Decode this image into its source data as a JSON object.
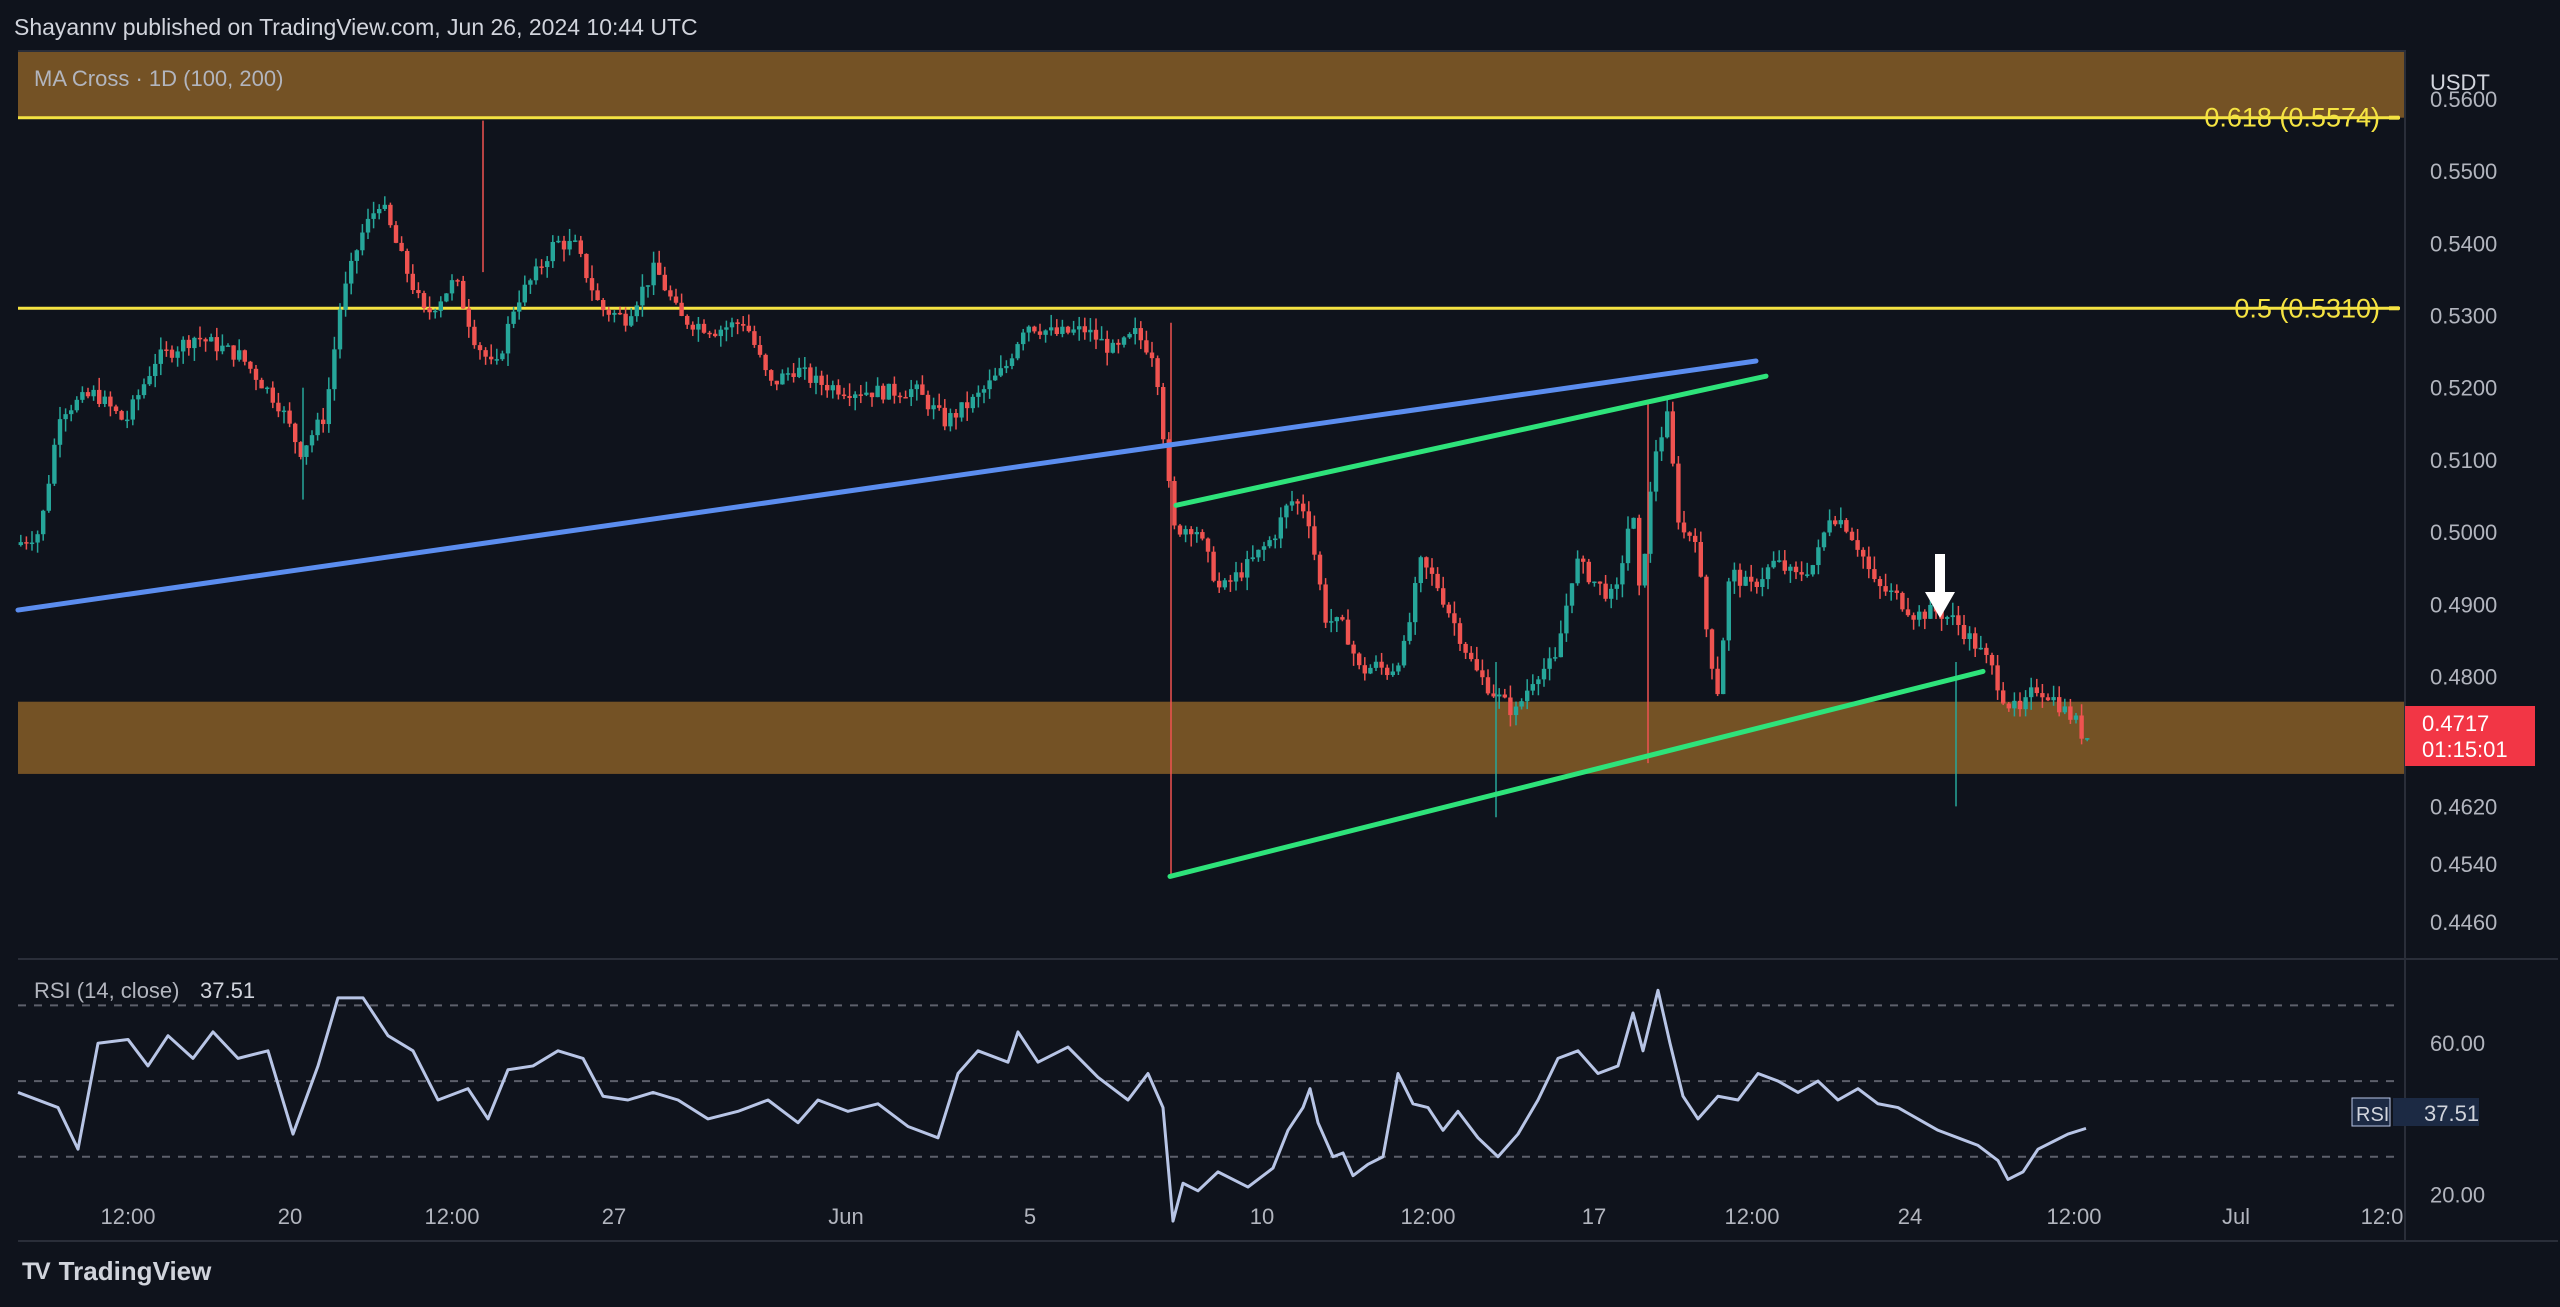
{
  "header": {
    "published": "Shayannv published on TradingView.com, Jun 26, 2024 10:44 UTC"
  },
  "brand": {
    "logo": "TV",
    "name": "TradingView"
  },
  "colors": {
    "up": "#26a69a",
    "down": "#ef5350",
    "zone": "#7a5526",
    "fib": "#f5e342",
    "blue_line": "#5b8def",
    "green_line": "#2ee37a",
    "rsi_line": "#b8c5e6",
    "price_tag": "#f23645"
  },
  "chart_data": [
    {
      "type": "candlestick",
      "title": "",
      "indicator_label": "MA Cross · 1D (100, 200)",
      "currency": "USDT",
      "x_tick_labels": [
        "12:00",
        "20",
        "12:00",
        "27",
        "Jun",
        "5",
        "10",
        "12:00",
        "17",
        "12:00",
        "24",
        "12:00",
        "Jul",
        "12:0"
      ],
      "y_tick_labels": [
        "0.5600",
        "0.5500",
        "0.5400",
        "0.5300",
        "0.5200",
        "0.5100",
        "0.5000",
        "0.4900",
        "0.4800",
        "0.4620",
        "0.4540",
        "0.4460"
      ],
      "y_tick_values": [
        0.56,
        0.55,
        0.54,
        0.53,
        0.52,
        0.51,
        0.5,
        0.49,
        0.48,
        0.462,
        0.454,
        0.446
      ],
      "ylim": [
        0.441,
        0.5665
      ],
      "grid": false,
      "zones": [
        {
          "from": 0.5574,
          "to": 0.5665,
          "label": ""
        },
        {
          "from": 0.4665,
          "to": 0.4765,
          "label": ""
        }
      ],
      "fib_levels": [
        {
          "value": 0.5574,
          "label": "0.618 (0.5574)"
        },
        {
          "value": 0.531,
          "label": "0.5 (0.5310)"
        }
      ],
      "trendlines": [
        {
          "name": "",
          "color": "blue",
          "points": [
            [
              0,
              0.4892
            ],
            [
              1738,
              0.5237
            ]
          ]
        },
        {
          "name": "",
          "color": "green",
          "points": [
            [
              1158,
              0.5037
            ],
            [
              1748,
              0.5216
            ]
          ]
        },
        {
          "name": "",
          "color": "green",
          "points": [
            [
              1152,
              0.4523
            ],
            [
              1965,
              0.4807
            ]
          ]
        }
      ],
      "last_price": {
        "value": 0.4717,
        "label": "0.4717",
        "countdown": "01:15:01"
      },
      "annotation": {
        "type": "down-arrow",
        "x": 1940,
        "y": 0.4935
      },
      "series_points": [
        [
          0,
          0.4982
        ],
        [
          25,
          0.5001
        ],
        [
          45,
          0.5168
        ],
        [
          80,
          0.5192
        ],
        [
          110,
          0.5152
        ],
        [
          140,
          0.5238
        ],
        [
          180,
          0.5271
        ],
        [
          225,
          0.5244
        ],
        [
          265,
          0.5175
        ],
        [
          285,
          0.5112
        ],
        [
          310,
          0.5162
        ],
        [
          325,
          0.5312
        ],
        [
          345,
          0.5408
        ],
        [
          365,
          0.546
        ],
        [
          385,
          0.5384
        ],
        [
          410,
          0.5299
        ],
        [
          440,
          0.5349
        ],
        [
          460,
          0.5266
        ],
        [
          480,
          0.5222
        ],
        [
          500,
          0.5318
        ],
        [
          520,
          0.5356
        ],
        [
          540,
          0.5402
        ],
        [
          560,
          0.5396
        ],
        [
          585,
          0.531
        ],
        [
          610,
          0.5296
        ],
        [
          640,
          0.5366
        ],
        [
          665,
          0.5296
        ],
        [
          700,
          0.528
        ],
        [
          730,
          0.5292
        ],
        [
          755,
          0.5203
        ],
        [
          780,
          0.5227
        ],
        [
          800,
          0.5208
        ],
        [
          830,
          0.5197
        ],
        [
          870,
          0.5194
        ],
        [
          900,
          0.5197
        ],
        [
          930,
          0.5153
        ],
        [
          960,
          0.5184
        ],
        [
          990,
          0.5227
        ],
        [
          1010,
          0.529
        ],
        [
          1040,
          0.5274
        ],
        [
          1070,
          0.528
        ],
        [
          1100,
          0.5249
        ],
        [
          1120,
          0.5275
        ],
        [
          1140,
          0.5244
        ],
        [
          1158,
          0.5003
        ],
        [
          1180,
          0.5009
        ],
        [
          1205,
          0.4918
        ],
        [
          1235,
          0.4957
        ],
        [
          1258,
          0.4993
        ],
        [
          1275,
          0.5044
        ],
        [
          1292,
          0.503
        ],
        [
          1310,
          0.4882
        ],
        [
          1330,
          0.4866
        ],
        [
          1345,
          0.4806
        ],
        [
          1360,
          0.4815
        ],
        [
          1375,
          0.4806
        ],
        [
          1390,
          0.4842
        ],
        [
          1405,
          0.4957
        ],
        [
          1420,
          0.4933
        ],
        [
          1440,
          0.4871
        ],
        [
          1460,
          0.4808
        ],
        [
          1480,
          0.4775
        ],
        [
          1500,
          0.4749
        ],
        [
          1520,
          0.4804
        ],
        [
          1540,
          0.482
        ],
        [
          1560,
          0.4961
        ],
        [
          1580,
          0.493
        ],
        [
          1600,
          0.4906
        ],
        [
          1620,
          0.4872
        ],
        [
          1600,
          0.4906
        ],
        [
          1618,
          0.5047
        ],
        [
          1630,
          0.4983
        ],
        [
          1640,
          0.5112
        ],
        [
          1652,
          0.5158
        ],
        [
          1665,
          0.4999
        ],
        [
          1680,
          0.4997
        ],
        [
          1690,
          0.4876
        ],
        [
          1702,
          0.4776
        ],
        [
          1715,
          0.4946
        ],
        [
          1735,
          0.4922
        ],
        [
          1760,
          0.4959
        ],
        [
          1780,
          0.4938
        ],
        [
          1800,
          0.4957
        ],
        [
          1815,
          0.5026
        ],
        [
          1830,
          0.5012
        ],
        [
          1845,
          0.4976
        ],
        [
          1860,
          0.4925
        ],
        [
          1880,
          0.4912
        ],
        [
          1900,
          0.4885
        ],
        [
          1920,
          0.4891
        ],
        [
          1940,
          0.4877
        ],
        [
          1960,
          0.4844
        ],
        [
          1975,
          0.4816
        ],
        [
          1990,
          0.4766
        ],
        [
          2005,
          0.4749
        ],
        [
          2020,
          0.4785
        ],
        [
          2035,
          0.4774
        ],
        [
          2050,
          0.4752
        ],
        [
          2060,
          0.4739
        ],
        [
          2068,
          0.4717
        ]
      ]
    },
    {
      "type": "line",
      "title": "",
      "indicator_label": "RSI (14, close)",
      "indicator_value": "37.51",
      "y_tick_labels": [
        "60.00",
        "20.00"
      ],
      "y_tick_values": [
        60,
        20
      ],
      "ylim": [
        8,
        82
      ],
      "guides": [
        70,
        50,
        30
      ],
      "last_value": {
        "label": "RSI",
        "value": "37.51"
      },
      "series_points": [
        [
          0,
          47
        ],
        [
          40,
          43
        ],
        [
          60,
          32
        ],
        [
          80,
          60
        ],
        [
          110,
          61
        ],
        [
          130,
          54
        ],
        [
          150,
          62
        ],
        [
          175,
          56
        ],
        [
          195,
          63
        ],
        [
          220,
          56
        ],
        [
          250,
          58
        ],
        [
          275,
          36
        ],
        [
          300,
          54
        ],
        [
          320,
          72
        ],
        [
          345,
          72
        ],
        [
          370,
          62
        ],
        [
          395,
          58
        ],
        [
          420,
          45
        ],
        [
          450,
          48
        ],
        [
          470,
          40
        ],
        [
          490,
          53
        ],
        [
          515,
          54
        ],
        [
          540,
          58
        ],
        [
          565,
          56
        ],
        [
          585,
          46
        ],
        [
          610,
          45
        ],
        [
          635,
          47
        ],
        [
          660,
          45
        ],
        [
          690,
          40
        ],
        [
          720,
          42
        ],
        [
          750,
          45
        ],
        [
          780,
          39
        ],
        [
          800,
          45
        ],
        [
          830,
          42
        ],
        [
          860,
          44
        ],
        [
          890,
          38
        ],
        [
          920,
          35
        ],
        [
          940,
          52
        ],
        [
          960,
          58
        ],
        [
          990,
          55
        ],
        [
          1000,
          63
        ],
        [
          1020,
          55
        ],
        [
          1050,
          59
        ],
        [
          1080,
          51
        ],
        [
          1110,
          45
        ],
        [
          1130,
          52
        ],
        [
          1145,
          43
        ],
        [
          1155,
          13
        ],
        [
          1165,
          23
        ],
        [
          1180,
          21
        ],
        [
          1200,
          26
        ],
        [
          1230,
          22
        ],
        [
          1255,
          27
        ],
        [
          1270,
          37
        ],
        [
          1285,
          43
        ],
        [
          1292,
          48
        ],
        [
          1300,
          39
        ],
        [
          1315,
          30
        ],
        [
          1325,
          31
        ],
        [
          1335,
          25
        ],
        [
          1350,
          28
        ],
        [
          1365,
          30
        ],
        [
          1380,
          52
        ],
        [
          1395,
          44
        ],
        [
          1410,
          43
        ],
        [
          1425,
          37
        ],
        [
          1440,
          42
        ],
        [
          1460,
          35
        ],
        [
          1480,
          30
        ],
        [
          1500,
          36
        ],
        [
          1520,
          45
        ],
        [
          1540,
          56
        ],
        [
          1560,
          58
        ],
        [
          1580,
          52
        ],
        [
          1600,
          54
        ],
        [
          1615,
          68
        ],
        [
          1625,
          58
        ],
        [
          1640,
          74
        ],
        [
          1652,
          60
        ],
        [
          1665,
          46
        ],
        [
          1680,
          40
        ],
        [
          1700,
          46
        ],
        [
          1720,
          45
        ],
        [
          1740,
          52
        ],
        [
          1760,
          50
        ],
        [
          1780,
          47
        ],
        [
          1800,
          50
        ],
        [
          1820,
          45
        ],
        [
          1840,
          48
        ],
        [
          1860,
          44
        ],
        [
          1880,
          43
        ],
        [
          1900,
          40
        ],
        [
          1920,
          37
        ],
        [
          1940,
          35
        ],
        [
          1960,
          33
        ],
        [
          1980,
          29
        ],
        [
          1990,
          24
        ],
        [
          2005,
          26
        ],
        [
          2020,
          32
        ],
        [
          2035,
          34
        ],
        [
          2050,
          36
        ],
        [
          2068,
          37.5
        ]
      ]
    }
  ]
}
